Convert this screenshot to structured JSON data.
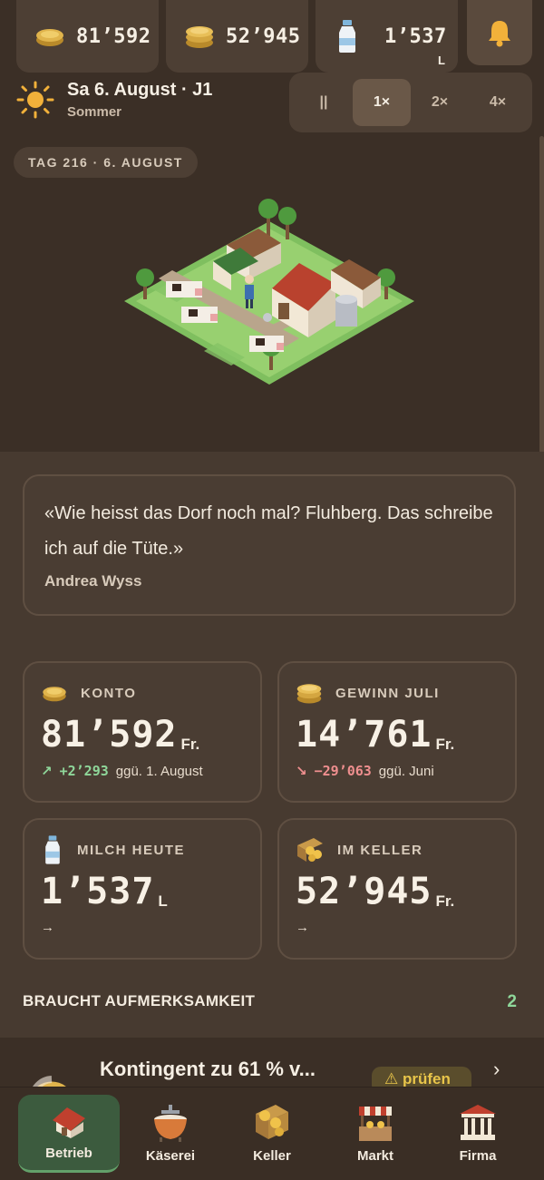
{
  "resources": {
    "money": "81’592",
    "cheese_value": "52’945",
    "milk": "1’537",
    "milk_unit": "L"
  },
  "date": {
    "title": "Sa 6. August · J1",
    "season": "Sommer"
  },
  "speed": {
    "pause": "||",
    "options": [
      "1×",
      "2×",
      "4×"
    ],
    "active": "1×"
  },
  "scene": {
    "day_pill": "TAG 216 · 6. AUGUST"
  },
  "quote": {
    "text": "«Wie heisst das Dorf noch mal? Fluhberg. Das schreibe ich auf die Tüte.»",
    "author": "Andrea Wyss"
  },
  "stats": {
    "konto": {
      "label": "KONTO",
      "value": "81’592",
      "unit": "Fr.",
      "delta": "+2’293",
      "delta_note": "ggü. 1. August",
      "arrow": "↗"
    },
    "gewinn": {
      "label": "GEWINN JULI",
      "value": "14’761",
      "unit": "Fr.",
      "delta": "−29’063",
      "delta_note": "ggü. Juni",
      "arrow": "↘"
    },
    "milch": {
      "label": "MILCH HEUTE",
      "value": "1’537",
      "unit": "L",
      "arrow": "→"
    },
    "keller": {
      "label": "IM KELLER",
      "value": "52’945",
      "unit": "Fr.",
      "arrow": "→"
    }
  },
  "attention": {
    "title": "BRAUCHT AUFMERKSAMKEIT",
    "count": "2",
    "task_title": "Kontingent zu 61 % v...",
    "task_action": "⚠ prüfen",
    "task_chevron": "›"
  },
  "nav": {
    "items": [
      "Betrieb",
      "Käserei",
      "Keller",
      "Markt",
      "Firma"
    ],
    "active": "Betrieb"
  },
  "colors": {
    "background": "#3a2e25",
    "card": "#4a3d33",
    "positive": "#8fd79a",
    "negative": "#ef8f8f",
    "active_nav": "#3c5b3e",
    "warning": "#e8c54a"
  }
}
